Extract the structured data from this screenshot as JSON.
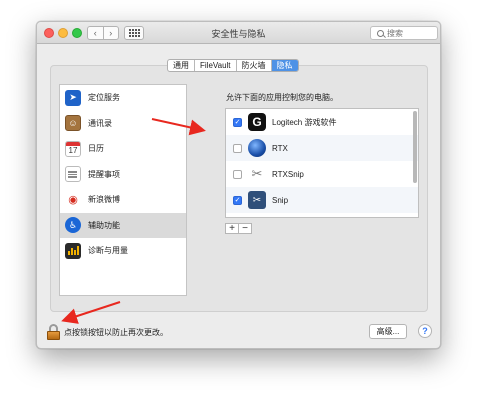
{
  "window": {
    "title": "安全性与隐私"
  },
  "search": {
    "placeholder": "搜索",
    "icon": "search-icon"
  },
  "nav": {
    "back_icon": "chevron-left-icon",
    "forward_icon": "chevron-right-icon",
    "grid_icon": "grid-icon"
  },
  "tabs": [
    {
      "label": "通用",
      "active": false
    },
    {
      "label": "FileVault",
      "active": false
    },
    {
      "label": "防火墙",
      "active": false
    },
    {
      "label": "隐私",
      "active": true
    }
  ],
  "sidebar": {
    "items": [
      {
        "label": "定位服务",
        "icon": "location-arrow-icon"
      },
      {
        "label": "通讯录",
        "icon": "contacts-book-icon"
      },
      {
        "label": "日历",
        "icon": "calendar-icon",
        "badge": "17"
      },
      {
        "label": "提醒事项",
        "icon": "reminders-list-icon"
      },
      {
        "label": "新浪微博",
        "icon": "weibo-icon"
      },
      {
        "label": "辅助功能",
        "icon": "accessibility-icon",
        "selected": true
      },
      {
        "label": "诊断与用量",
        "icon": "diagnostics-chart-icon"
      }
    ]
  },
  "right_panel": {
    "label": "允许下面的应用控制您的电脑。",
    "apps": [
      {
        "name": "Logitech 游戏软件",
        "checked": true,
        "icon": "logitech-g-icon"
      },
      {
        "name": "RTX",
        "checked": false,
        "icon": "rtx-globe-icon"
      },
      {
        "name": "RTXSnip",
        "checked": false,
        "icon": "rtxsnip-icon"
      },
      {
        "name": "Snip",
        "checked": true,
        "icon": "snip-icon"
      }
    ],
    "add_label": "+",
    "remove_label": "−"
  },
  "footer": {
    "lock_text": "点按锁按钮以防止再次更改。",
    "advanced_label": "高级...",
    "help_label": "?"
  },
  "colors": {
    "accent": "#3478f6",
    "arrow": "#e8281f"
  }
}
